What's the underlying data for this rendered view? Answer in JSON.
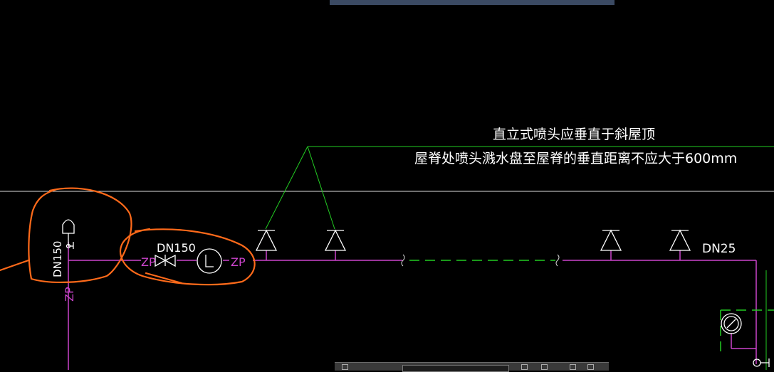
{
  "annotation": {
    "line1": "直立式喷头应垂直于斜屋顶",
    "line2": "屋脊处喷头溅水盘至屋脊的垂直距离不应大于600mm"
  },
  "pipe_labels": {
    "dn150": "DN150",
    "dn150_vertical": "DN150",
    "dn25": "DN25",
    "zp_vertical": "ZP",
    "zp_left": "ZP",
    "zp_right": "ZP"
  },
  "colors": {
    "background": "#000000",
    "pipe": "#cc44cc",
    "green": "#22cc22",
    "white": "#ffffff",
    "markup": "#ff6a1a",
    "toolbar": "#3a3a3a",
    "topbar": "#3b4a63"
  },
  "icons": {
    "sprinkler": "upright-sprinkler-icon",
    "valve": "gate-valve-icon",
    "flow_meter": "flow-indicator-icon",
    "gauge": "pressure-gauge-icon"
  }
}
